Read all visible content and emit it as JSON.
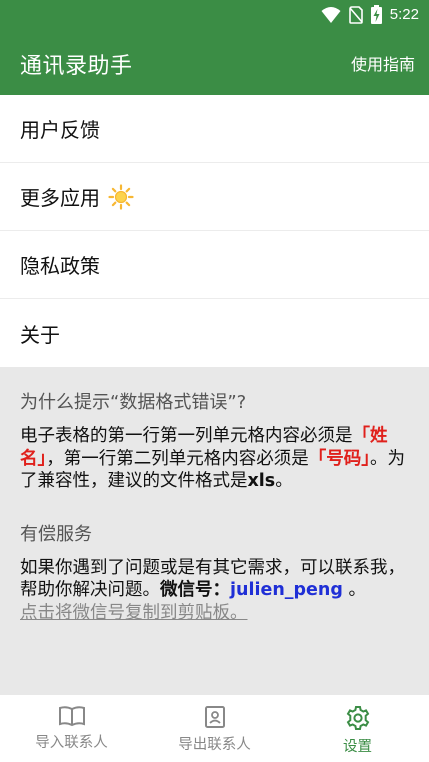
{
  "status_bar": {
    "time": "5:22",
    "icons": [
      "wifi-icon",
      "sim-off-icon",
      "battery-charging-icon"
    ]
  },
  "app_bar": {
    "title": "通讯录助手",
    "guide_label": "使用指南"
  },
  "menu": {
    "items": [
      {
        "label": "用户反馈"
      },
      {
        "label": "更多应用"
      },
      {
        "label": "隐私政策"
      },
      {
        "label": "关于"
      }
    ]
  },
  "info": {
    "format_title": "为什么提示“数据格式错误”?",
    "format_body": {
      "part1": "电子表格的第一行第一列单元格内容必须是",
      "q1_open": "「",
      "name": "姓名",
      "q1_close": "」",
      "part2": "，第一行第二列单元格内容必须是",
      "q2_open": "「",
      "number": "号码",
      "q2_close": "」",
      "part3": "。为了兼容性，建议的文件格式是",
      "ext": "xls",
      "end": "。"
    },
    "paid_title": "有偿服务",
    "paid_body": {
      "part1": "如果你遇到了问题或是有其它需求，可以联系我，帮助你解决问题。",
      "wechat_label": "微信号：",
      "wechat_id": "julien_peng",
      "end": " 。",
      "copy_link": "点击将微信号复制到剪贴板。"
    }
  },
  "bottom_nav": {
    "items": [
      {
        "label": "导入联系人",
        "icon": "book-icon"
      },
      {
        "label": "导出联系人",
        "icon": "contact-card-icon"
      },
      {
        "label": "设置",
        "icon": "gear-icon"
      }
    ],
    "active_color": "#3b8d45"
  },
  "colors": {
    "primary": "#3b8d45",
    "highlight_red": "#e0201b",
    "highlight_blue": "#1f2fd6"
  }
}
